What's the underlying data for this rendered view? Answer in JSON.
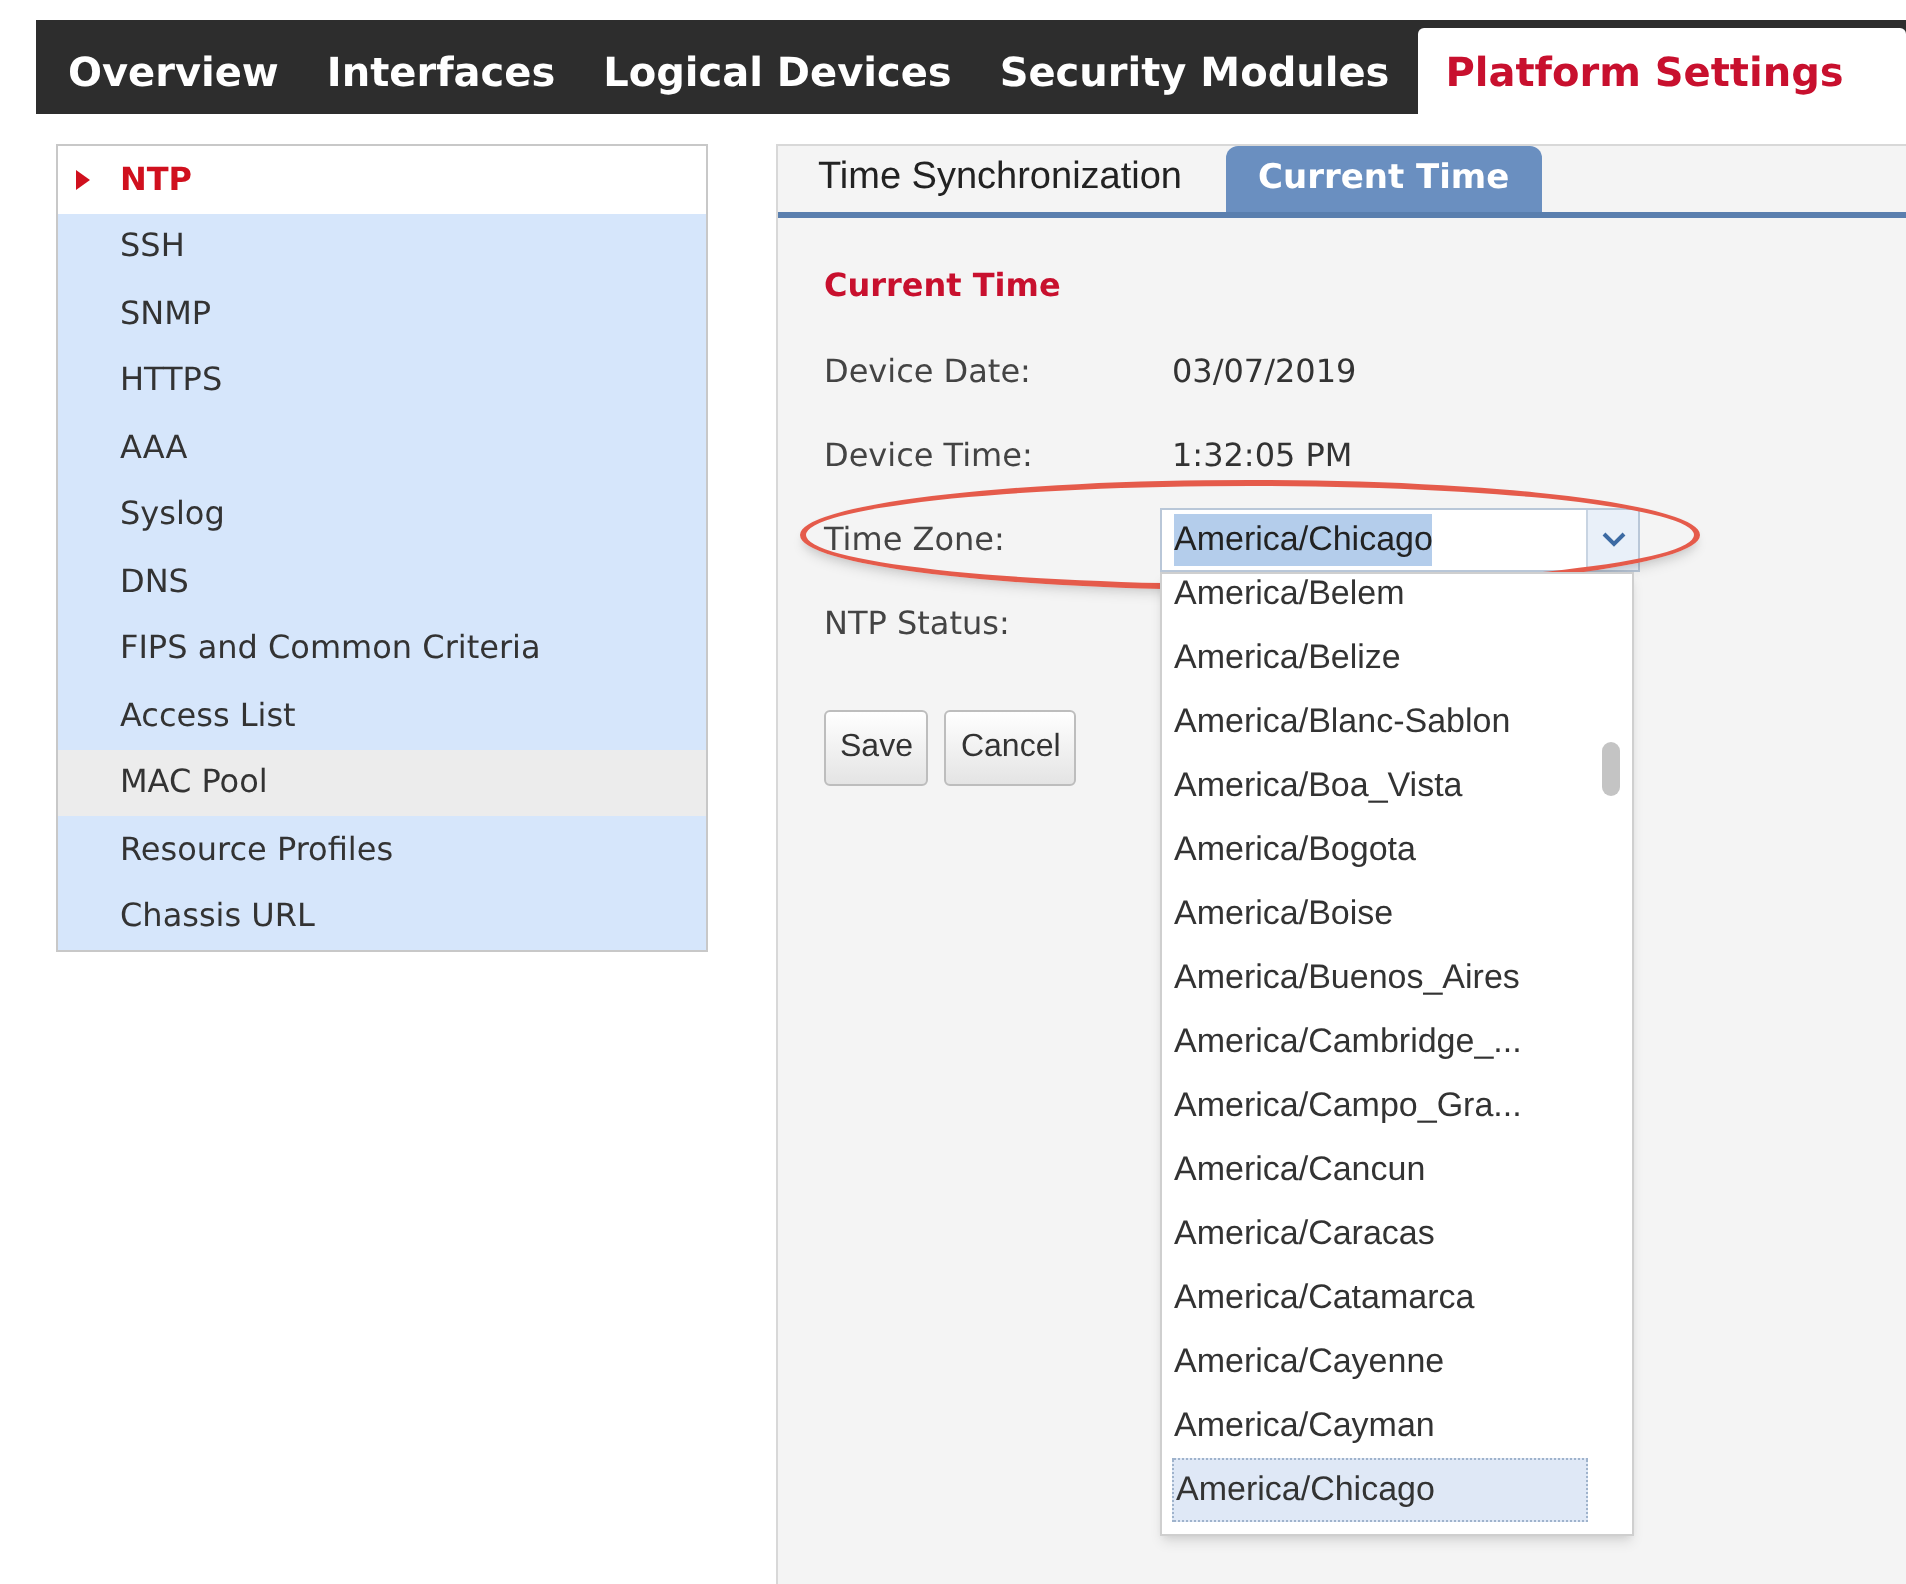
{
  "top_tabs": [
    {
      "label": "Overview",
      "selected": false
    },
    {
      "label": "Interfaces",
      "selected": false
    },
    {
      "label": "Logical Devices",
      "selected": false
    },
    {
      "label": "Security Modules",
      "selected": false
    },
    {
      "label": "Platform Settings",
      "selected": true
    }
  ],
  "sidebar": {
    "items": [
      {
        "label": "NTP",
        "selected": true,
        "hovered": false
      },
      {
        "label": "SSH",
        "selected": false,
        "hovered": false
      },
      {
        "label": "SNMP",
        "selected": false,
        "hovered": false
      },
      {
        "label": "HTTPS",
        "selected": false,
        "hovered": false
      },
      {
        "label": "AAA",
        "selected": false,
        "hovered": false
      },
      {
        "label": "Syslog",
        "selected": false,
        "hovered": false
      },
      {
        "label": "DNS",
        "selected": false,
        "hovered": false
      },
      {
        "label": "FIPS and Common Criteria",
        "selected": false,
        "hovered": false
      },
      {
        "label": "Access List",
        "selected": false,
        "hovered": false
      },
      {
        "label": "MAC Pool",
        "selected": false,
        "hovered": true
      },
      {
        "label": "Resource Profiles",
        "selected": false,
        "hovered": false
      },
      {
        "label": "Chassis URL",
        "selected": false,
        "hovered": false
      }
    ]
  },
  "sub_tabs": [
    {
      "label": "Time Synchronization",
      "selected": false
    },
    {
      "label": "Current Time",
      "selected": true
    }
  ],
  "section_title": "Current Time",
  "fields": [
    {
      "label": "Device Date:",
      "value": "03/07/2019"
    },
    {
      "label": "Device Time:",
      "value": "1:32:05 PM"
    }
  ],
  "time_zone": {
    "label": "Time Zone:",
    "value": "America/Chicago",
    "highlighted": true
  },
  "ntp_status": {
    "label": "NTP Status:"
  },
  "buttons": [
    "Save",
    "Cancel"
  ],
  "dropdown_options": [
    {
      "label": "America/Belem",
      "selected": false
    },
    {
      "label": "America/Belize",
      "selected": false
    },
    {
      "label": "America/Blanc-Sablon",
      "selected": false
    },
    {
      "label": "America/Boa_Vista",
      "selected": false
    },
    {
      "label": "America/Bogota",
      "selected": false
    },
    {
      "label": "America/Boise",
      "selected": false
    },
    {
      "label": "America/Buenos_Aires",
      "selected": false
    },
    {
      "label": "America/Cambridge_...",
      "selected": false
    },
    {
      "label": "America/Campo_Gra...",
      "selected": false
    },
    {
      "label": "America/Cancun",
      "selected": false
    },
    {
      "label": "America/Caracas",
      "selected": false
    },
    {
      "label": "America/Catamarca",
      "selected": false
    },
    {
      "label": "America/Cayenne",
      "selected": false
    },
    {
      "label": "America/Cayman",
      "selected": false
    },
    {
      "label": "America/Chicago",
      "selected": true
    }
  ]
}
